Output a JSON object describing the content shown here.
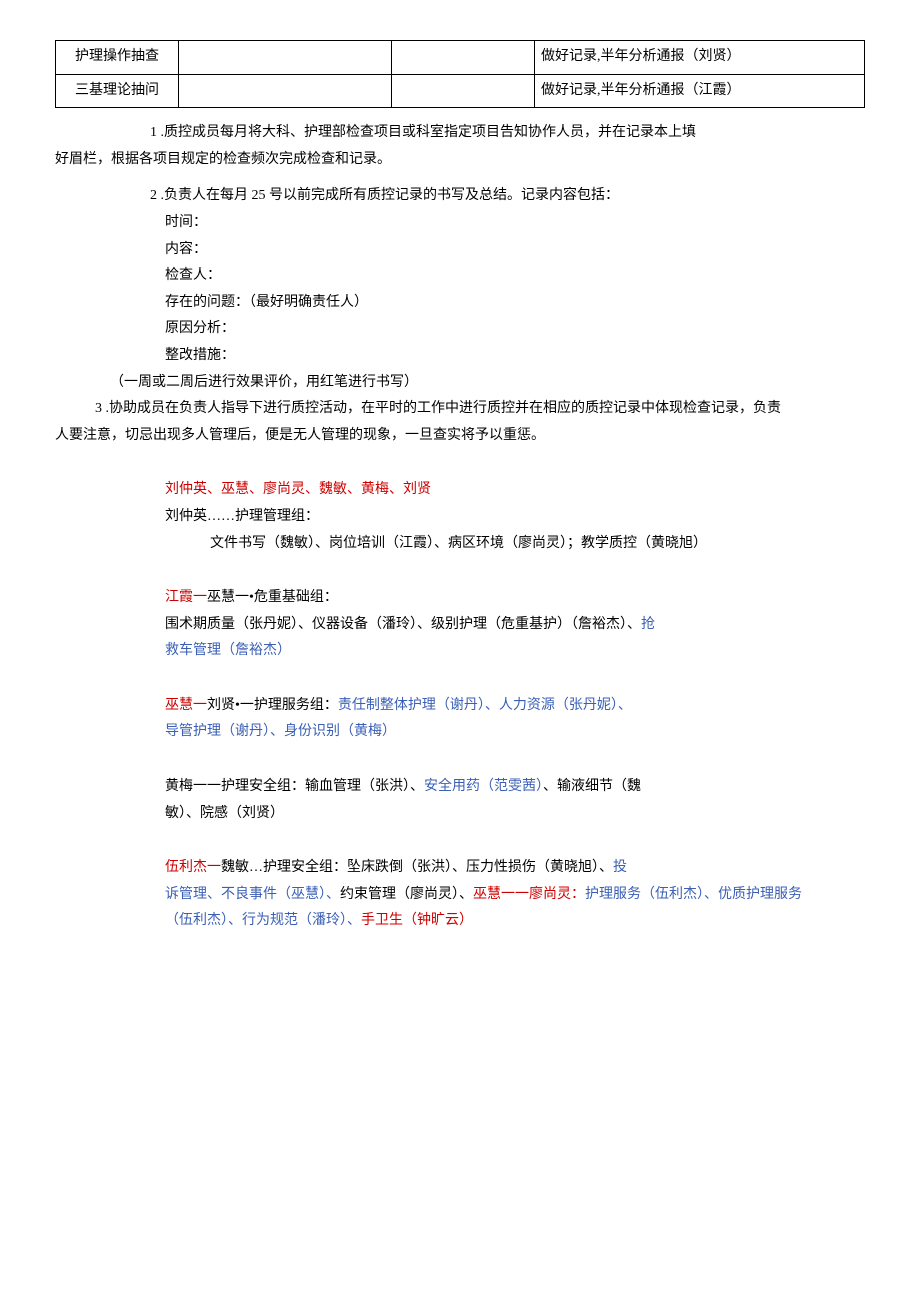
{
  "table": {
    "row1": {
      "c1": "护理操作抽查",
      "c4": "做好记录,半年分析通报（刘贤）"
    },
    "row2": {
      "c1": "三基理论抽问",
      "c4": "做好记录,半年分析通报（江霞）"
    }
  },
  "p1a": "1  .质控成员每月将大科、护理部检查项目或科室指定项目告知协作人员，并在记录本上填",
  "p1b": "好眉栏，根据各项目规定的检查频次完成检查和记录。",
  "p2": "2  .负责人在每月 25 号以前完成所有质控记录的书写及总结。记录内容包括：",
  "li1": "时间：",
  "li2": "内容：",
  "li3": "检查人：",
  "li4": "存在的问题：（最好明确责任人）",
  "li5": "原因分析：",
  "li6": " 整改措施：",
  "p3": "（一周或二周后进行效果评价，用红笔进行书写）",
  "p4a": "3  .协助成员在负责人指导下进行质控活动，在平时的工作中进行质控并在相应的质控记录中体现检查记录，负责",
  "p4b": "人要注意，切忌出现多人管理后，便是无人管理的现象，一旦查实将予以重惩。",
  "g1": "刘仲英、巫慧、廖尚灵、魏敏、黄梅、刘贤",
  "g2": "刘仲英……护理管理组：",
  "g3": "文件书写（魏敏）、岗位培训（江霞）、病区环境（廖尚灵）；教学质控（黄晓旭）",
  "g4a": "江霞一",
  "g4b": "巫慧一•危重基础组：",
  "g5a": "围术期质量（张丹妮）、仪器设备（潘玲）、级别护理（危重基护）（詹裕杰）、",
  "g5b": "抢",
  "g6": "救车管理（詹裕杰）",
  "g7a": "巫慧一",
  "g7b": "刘贤•一护理服务组：",
  "g7c": "责任制整体护理（谢丹）、人力资源（张丹妮）、",
  "g8": "导管护理（谢丹）、身份识别（黄梅）",
  "g9a": "黄梅一一护理安全组：输血管理（张洪）、",
  "g9b": "安全用药（范雯茜）",
  "g9c": "、输液细节（魏",
  "g10": "敏）、院感（刘贤）",
  "g11a": "伍利杰一",
  "g11b": "魏敏…护理安全组：坠床跌倒（张洪）、压力性损伤（黄晓旭）、",
  "g11c": "投",
  "g12a": "诉管理、不良事件（巫慧）、",
  "g12b": "约束管理（廖尚灵）、",
  "g12c": "巫慧一一廖尚灵：",
  "g12d": "护理服务（伍利杰）、优质护理服务",
  "g13a": "（伍利杰）、行为规范（潘玲）、",
  "g13b": "手卫生（钟旷云）"
}
